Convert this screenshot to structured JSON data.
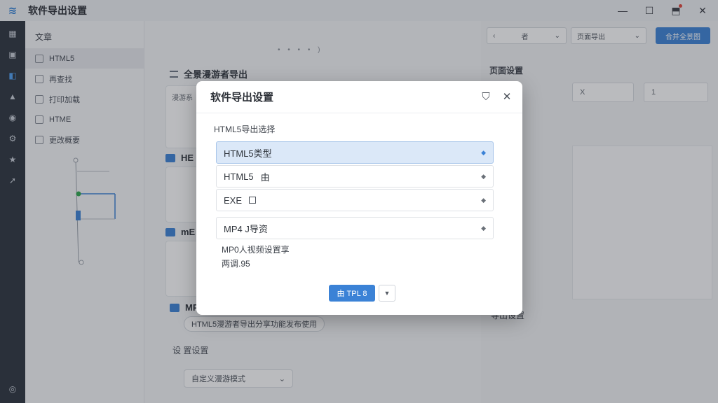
{
  "app": {
    "title": "软件导出设置",
    "logo_icon": "≋"
  },
  "window": {
    "minimize": "—",
    "maximize": "☐",
    "notify": "⬒",
    "close": "✕"
  },
  "colors": {
    "accent": "#3b82d6",
    "rail": "#2c333d",
    "selected_option": "#dbe8f8"
  },
  "left_panel": {
    "title": "文章",
    "items": [
      {
        "label": "HTML5"
      },
      {
        "label": "再查找"
      },
      {
        "label": "打印加载"
      },
      {
        "label": "HTME"
      },
      {
        "label": "更改概要"
      }
    ]
  },
  "middle": {
    "dots": "• • • • )",
    "section1_title": "全景漫游者导出",
    "section1_sub": "漫游系",
    "section2_title": "HE",
    "section3_title": "mE",
    "section4_title": "MP",
    "chip_text": "HTML5漫游者导出分享功能发布使用",
    "section5_title": "设 置设置",
    "select_text": "自定义漫游模式"
  },
  "right_panel": {
    "select1": "者",
    "select2": "页面导出",
    "primary": "合并全景图",
    "label1": "页面设置",
    "label2": "导出设置",
    "num1": "X",
    "num2": "1"
  },
  "modal": {
    "title": "软件导出设置",
    "subtitle": "HTML5导出选择",
    "options": [
      {
        "label": "HTML5类型",
        "extra": ""
      },
      {
        "label": "HTML5",
        "extra": "由"
      },
      {
        "label": "EXE",
        "extra": ""
      },
      {
        "label": "MP4 J导资",
        "extra": ""
      }
    ],
    "note1": "MP0人视频设置享",
    "note2": "两调.95",
    "ok_label": "由 TPL 8",
    "caret": "◆",
    "dropdown": "▼"
  }
}
